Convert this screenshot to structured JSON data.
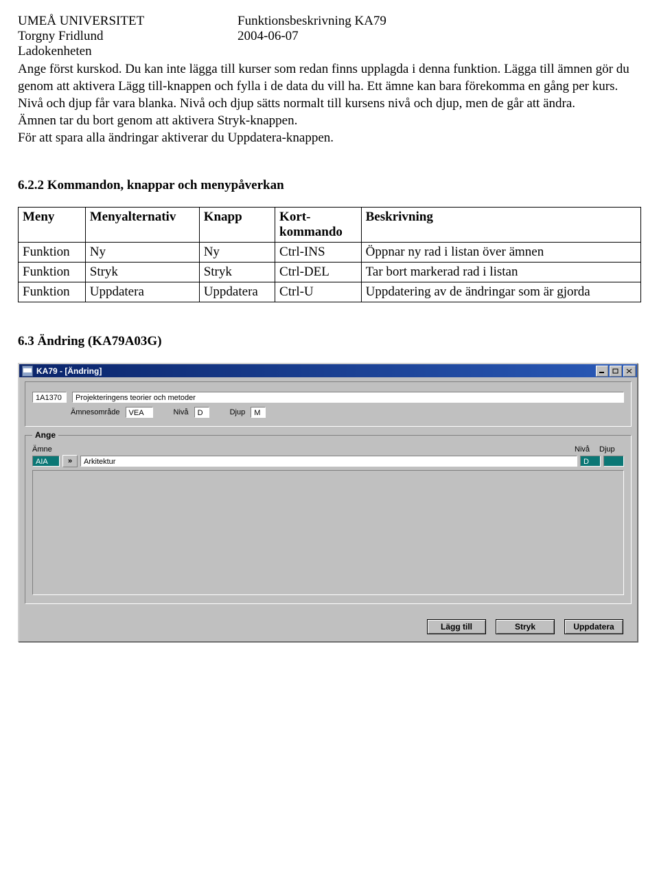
{
  "header": {
    "org": "UMEÅ UNIVERSITET",
    "doc": "Funktionsbeskrivning KA79",
    "author": "Torgny Fridlund",
    "date": "2004-06-07",
    "unit": "Ladokenheten"
  },
  "body_text": "Ange först kurskod. Du kan inte lägga till kurser som redan finns upplagda i denna funktion. Lägga till ämnen gör du genom att aktivera Lägg till-knappen och fylla i de data du vill ha. Ett ämne kan bara förekomma en gång per kurs. Nivå och djup får vara blanka. Nivå och djup sätts normalt till kursens nivå och djup, men de går att ändra.\nÄmnen tar du bort genom att aktivera Stryk-knappen.\nFör att spara alla ändringar aktiverar du Uppdatera-knappen.",
  "section_622": "6.2.2  Kommandon, knappar och menypåverkan",
  "cmd_table": {
    "headers": [
      "Meny",
      "Menyalternativ",
      "Knapp",
      "Kort-\nkommando",
      "Beskrivning"
    ],
    "rows": [
      [
        "Funktion",
        "Ny",
        "Ny",
        "Ctrl-INS",
        "Öppnar ny rad i listan över ämnen"
      ],
      [
        "Funktion",
        "Stryk",
        "Stryk",
        "Ctrl-DEL",
        "Tar bort markerad rad i listan"
      ],
      [
        "Funktion",
        "Uppdatera",
        "Uppdatera",
        "Ctrl-U",
        "Uppdatering av de ändringar som är gjorda"
      ]
    ]
  },
  "section_63": "6.3 Ändring  (KA79A03G)",
  "app": {
    "title": "KA79 - [Ändring]",
    "info": {
      "code": "1A1370",
      "name": "Projekteringens teorier och metoder",
      "amnesomrade_label": "Ämnesområde",
      "amnesomrade": "VEA",
      "niva_label": "Nivå",
      "niva": "D",
      "djup_label": "Djup",
      "djup": "M"
    },
    "ange": {
      "legend": "Ange",
      "hdr_amne": "Ämne",
      "hdr_niva": "Nivå",
      "hdr_djup": "Djup",
      "code": "AIA",
      "lookup": "»",
      "desc": "Arkitektur",
      "niva": "D",
      "djup": ""
    },
    "buttons": {
      "add": "Lägg till",
      "del": "Stryk",
      "upd": "Uppdatera"
    }
  }
}
